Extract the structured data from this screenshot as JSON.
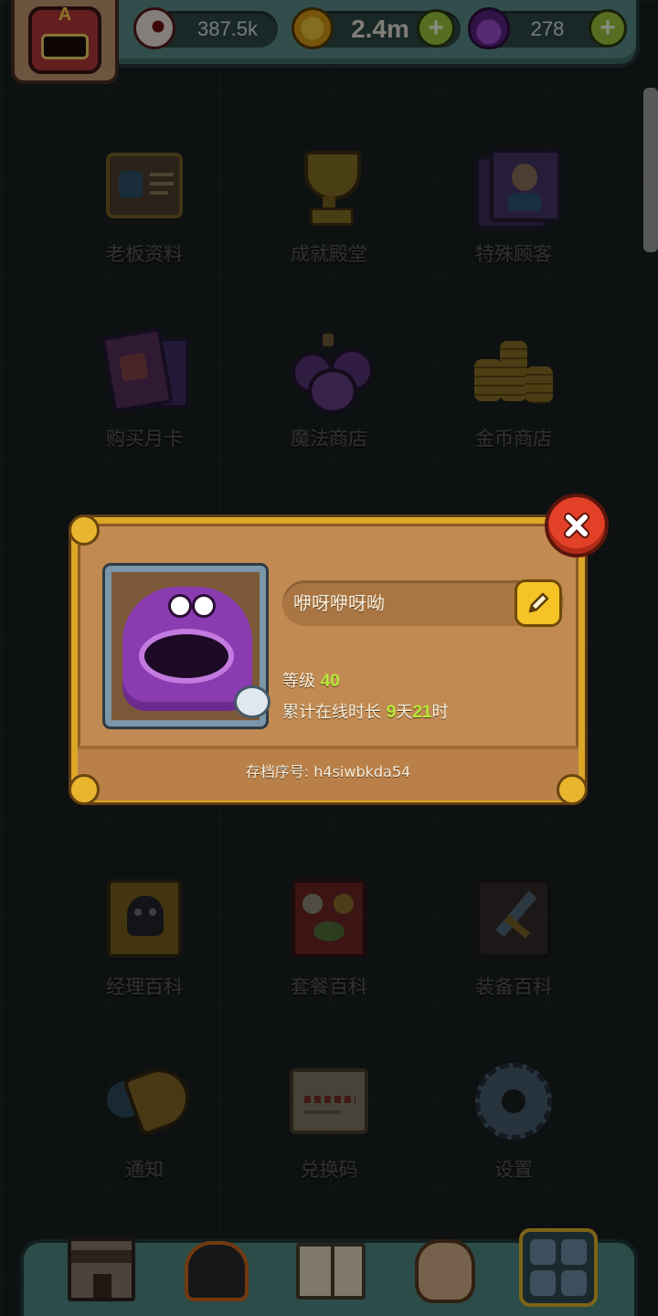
{
  "resources": {
    "eyes": {
      "icon": "eyeball-icon",
      "value": "387.5k"
    },
    "coins": {
      "icon": "gold-coin-icon",
      "value": "2.4m"
    },
    "potions": {
      "icon": "potion-icon",
      "value": "278"
    }
  },
  "badge": {
    "icon": "boss-avatar-icon",
    "letter": "A"
  },
  "menu": [
    {
      "icon": "boss-profile-icon",
      "label": "老板资料"
    },
    {
      "icon": "trophy-icon",
      "label": "成就殿堂"
    },
    {
      "icon": "special-customer-icon",
      "label": "特殊顾客"
    },
    {
      "icon": "monthly-card-icon",
      "label": "购买月卡"
    },
    {
      "icon": "magic-shop-icon",
      "label": "魔法商店"
    },
    {
      "icon": "coin-shop-icon",
      "label": "金币商店"
    },
    {
      "icon": "manager-book-icon",
      "label": "经理百科"
    },
    {
      "icon": "meal-book-icon",
      "label": "套餐百科"
    },
    {
      "icon": "equipment-book-icon",
      "label": "装备百科"
    },
    {
      "icon": "notification-horn-icon",
      "label": "通知"
    },
    {
      "icon": "redeem-scroll-icon",
      "label": "兑换码"
    },
    {
      "icon": "gear-icon",
      "label": "设置"
    }
  ],
  "bottom_nav": [
    {
      "icon": "shop-building-icon"
    },
    {
      "icon": "monster-fire-icon"
    },
    {
      "icon": "book-icon"
    },
    {
      "icon": "money-bag-icon"
    },
    {
      "icon": "grid-menu-icon"
    }
  ],
  "profile": {
    "name": "咿呀咿呀呦",
    "level_label": "等级",
    "level_value": "40",
    "online_label": "累计在线时长",
    "online_days": "9",
    "days_unit": "天",
    "online_hours": "21",
    "hours_unit": "时",
    "save_label": "存档序号: h4siwbkda54"
  },
  "colors": {
    "accent_green": "#b8e83a",
    "panel": "#c08a52",
    "frame_gold": "#dca627",
    "close_red": "#e24128"
  }
}
